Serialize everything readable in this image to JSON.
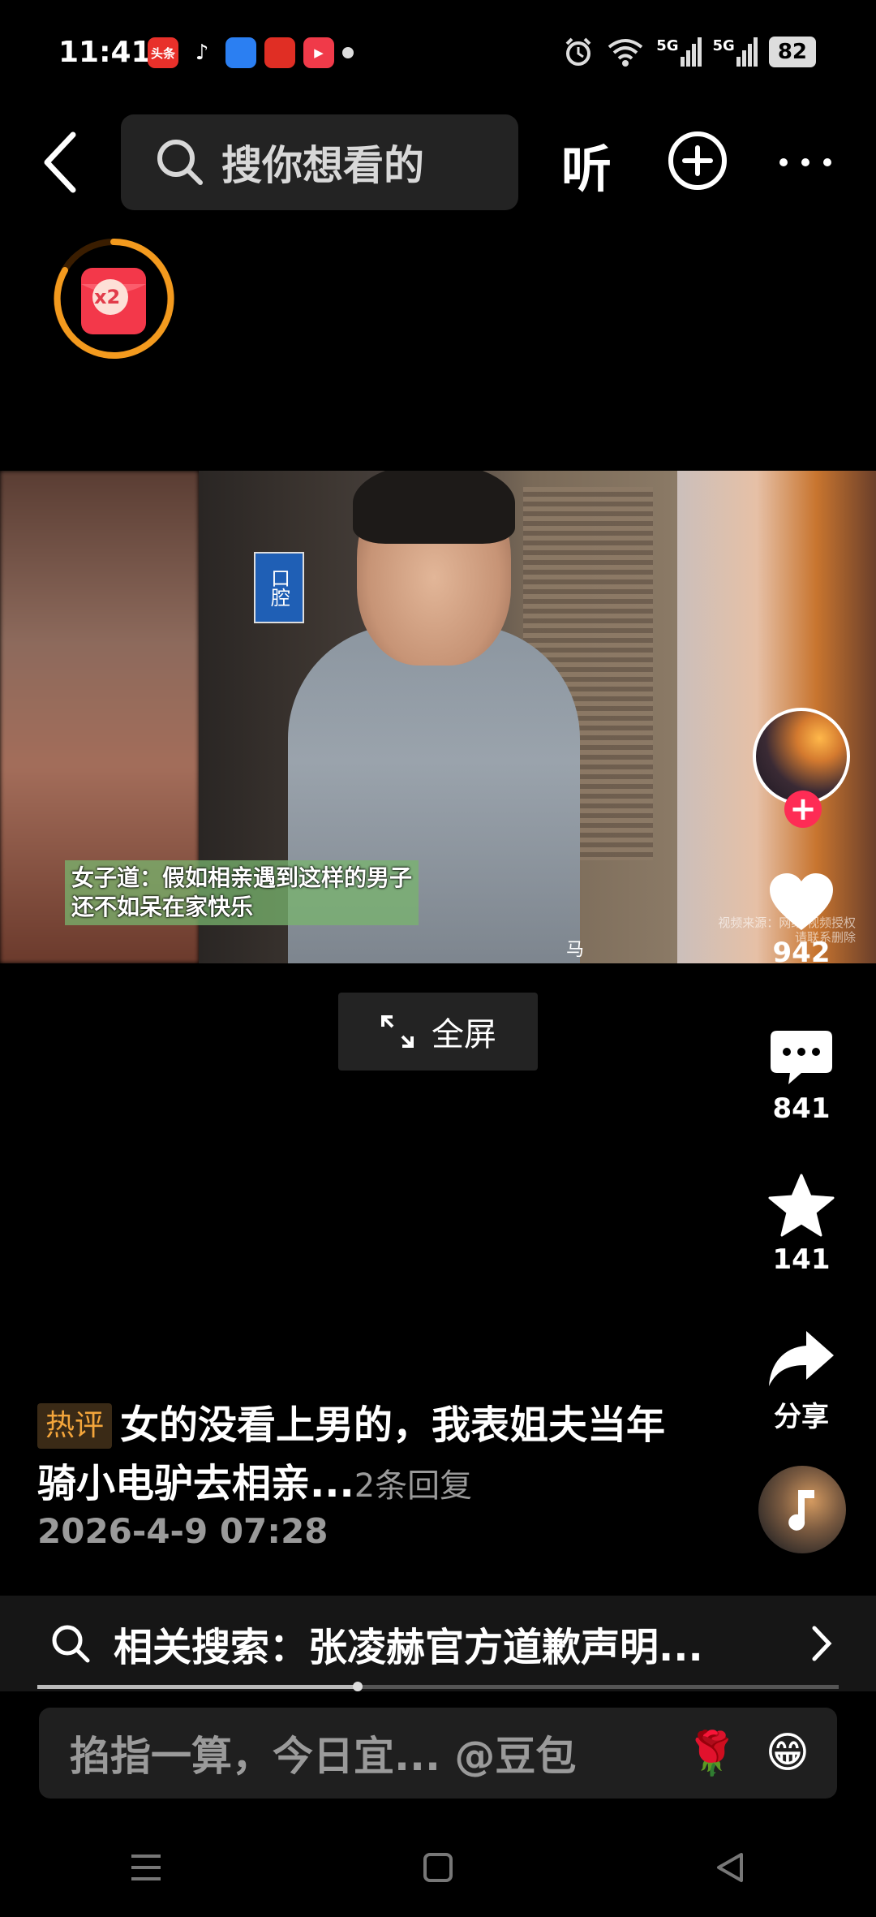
{
  "status": {
    "time": "11:41",
    "apps": [
      {
        "name": "toutiao-app-icon",
        "label": "头条",
        "color": "#e8302a"
      },
      {
        "name": "tiktok-app-icon",
        "label": "♪",
        "color": "#000000"
      },
      {
        "name": "blue-app-icon",
        "label": "",
        "color": "#2b7ff2"
      },
      {
        "name": "pinduoduo-app-icon",
        "label": "",
        "color": "#e02e24"
      },
      {
        "name": "video-app-icon",
        "label": "▶",
        "color": "#f03a49"
      }
    ],
    "network": "5G",
    "battery": "82"
  },
  "topbar": {
    "search_placeholder": "搜你想看的",
    "listen_label": "听"
  },
  "redpacket": {
    "label": "x2"
  },
  "video": {
    "caption_line1": "女子道：假如相亲遇到这样的男子",
    "caption_line2": "还不如呆在家快乐",
    "sign_text": "口腔",
    "tag_text": "马",
    "watermark": "视频来源：网络 视频授权 请联系删除"
  },
  "fullscreen_label": "全屏",
  "actions": {
    "like_count": "942",
    "comment_count": "841",
    "favorite_count": "141",
    "share_label": "分享"
  },
  "description": {
    "tag": "热评",
    "text": "女的没看上男的，我表姐夫当年骑小电驴去相亲...",
    "replies": "2条回复",
    "date": "2026-4-9 07:28"
  },
  "related_search": {
    "text": "相关搜索：张凌赫官方道歉声明..."
  },
  "playback_progress": 0.4,
  "comment_input": {
    "placeholder": "掐指一算，今日宜... @豆包",
    "emoji1": "🌹",
    "emoji2": "😁"
  },
  "colors": {
    "accent": "#fe2c55",
    "tag_orange": "#f3a53b",
    "background": "#000000"
  }
}
